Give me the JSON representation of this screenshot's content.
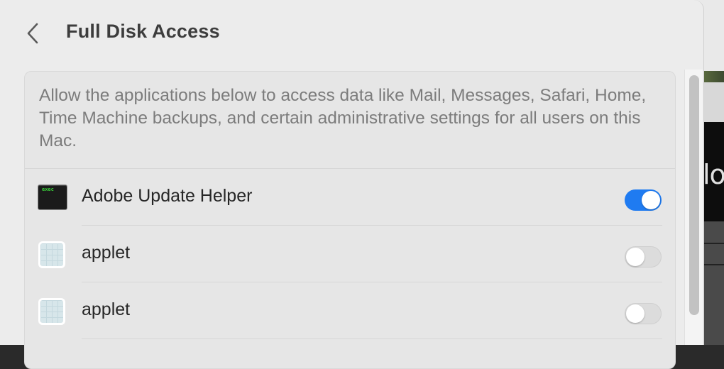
{
  "header": {
    "title": "Full Disk Access",
    "back_icon": "chevron-left-icon"
  },
  "card": {
    "description": "Allow the applications below to access data like Mail, Messages, Safari, Home, Time Machine backups, and certain administrative settings for all users on this Mac."
  },
  "apps": [
    {
      "name": "Adobe Update Helper",
      "icon": "exec-icon",
      "icon_text": "exec",
      "enabled": true
    },
    {
      "name": "applet",
      "icon": "applet-icon",
      "enabled": false
    },
    {
      "name": "applet",
      "icon": "applet-icon",
      "enabled": false
    }
  ],
  "background": {
    "partial_text": "lo"
  },
  "colors": {
    "accent": "#1f7bf1",
    "toggle_off": "#dcdcdc",
    "window_bg": "#ececec",
    "card_bg": "#e6e6e6"
  }
}
